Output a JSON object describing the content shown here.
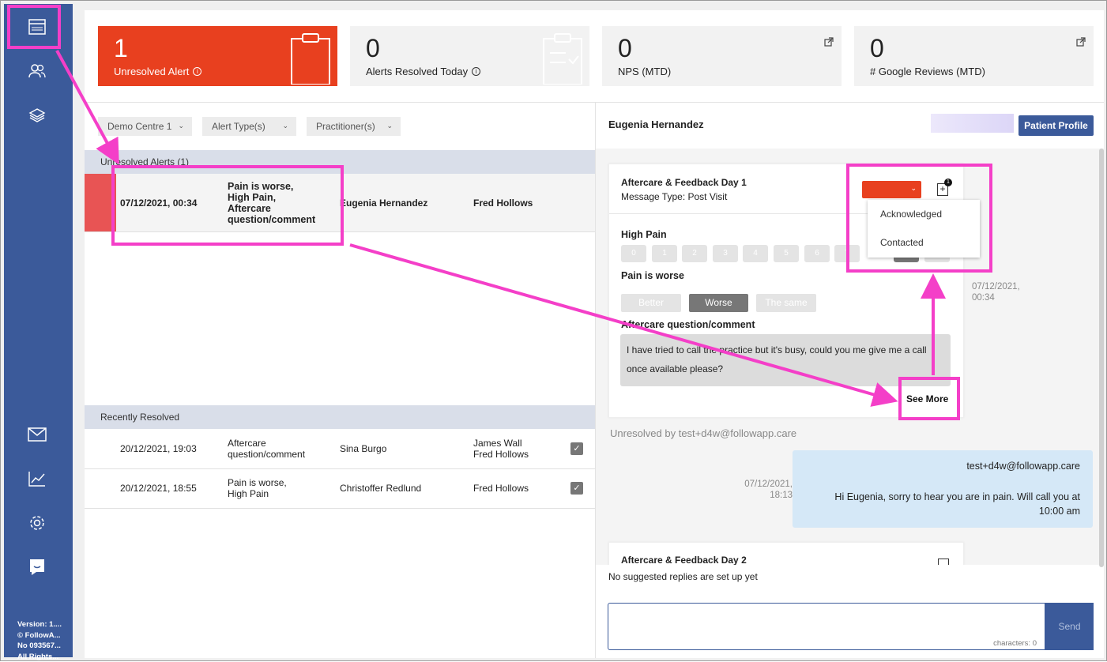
{
  "kpis": [
    {
      "number": "1",
      "label": "Unresolved Alert"
    },
    {
      "number": "0",
      "label": "Alerts Resolved Today"
    },
    {
      "number": "0",
      "label": "NPS (MTD)"
    },
    {
      "number": "0",
      "label": "# Google Reviews (MTD)"
    }
  ],
  "filters": [
    "Demo Centre 1",
    "Alert Type(s)",
    "Practitioner(s)"
  ],
  "unresolved": {
    "header": "Unresolved Alerts (1)",
    "row": {
      "date": "07/12/2021, 00:34",
      "alerts": [
        "Pain is worse,",
        "High Pain,",
        "Aftercare",
        "question/comment"
      ],
      "patient": "Eugenia Hernandez",
      "practitioner": "Fred Hollows"
    }
  },
  "resolved": {
    "header": "Recently Resolved",
    "rows": [
      {
        "date": "20/12/2021, 19:03",
        "alerts": [
          "Aftercare",
          "question/comment"
        ],
        "patient": "Sina Burgo",
        "practitioners": [
          "James Wall",
          "Fred Hollows"
        ]
      },
      {
        "date": "20/12/2021, 18:55",
        "alerts": [
          "Pain is worse,",
          "High Pain"
        ],
        "patient": "Christoffer Redlund",
        "practitioners": [
          "Fred Hollows"
        ]
      }
    ]
  },
  "detail": {
    "patient_name": "Eugenia Hernandez",
    "profile_button": "Patient Profile",
    "message": {
      "title": "Aftercare & Feedback Day 1",
      "type": "Message Type: Post Visit",
      "q1": "High Pain",
      "scale": [
        "0",
        "1",
        "2",
        "3",
        "4",
        "5",
        "6",
        "7",
        "8",
        "9"
      ],
      "q2": "Pain is worse",
      "options": [
        "Better",
        "Worse",
        "The same"
      ],
      "q3": "Aftercare question/comment",
      "comment": "I have tried to call the practice but it's busy, could you me give me a call once available please?",
      "see_more": "See More",
      "timestamp": [
        "07/12/2021,",
        "00:34"
      ],
      "badge": "1"
    },
    "status_menu": [
      "Acknowledged",
      "Contacted"
    ],
    "unresolved_by": "Unresolved by test+d4w@followapp.care",
    "reply": {
      "from": "test+d4w@followapp.care",
      "text": "Hi Eugenia, sorry to hear you are in pain. Will call you at 10:00 am",
      "timestamp": [
        "07/12/2021,",
        "18:13"
      ]
    },
    "next_message_title": "Aftercare & Feedback Day 2",
    "suggested": "No suggested replies are set up yet",
    "characters": "characters: 0",
    "send": "Send"
  },
  "footer": [
    "Version: 1....",
    "© FollowA...",
    "No 093567...",
    "All Rights..."
  ],
  "colors": {
    "brand": "#3b5a9a",
    "alert": "#e8401f",
    "highlight": "#f43fc8"
  }
}
